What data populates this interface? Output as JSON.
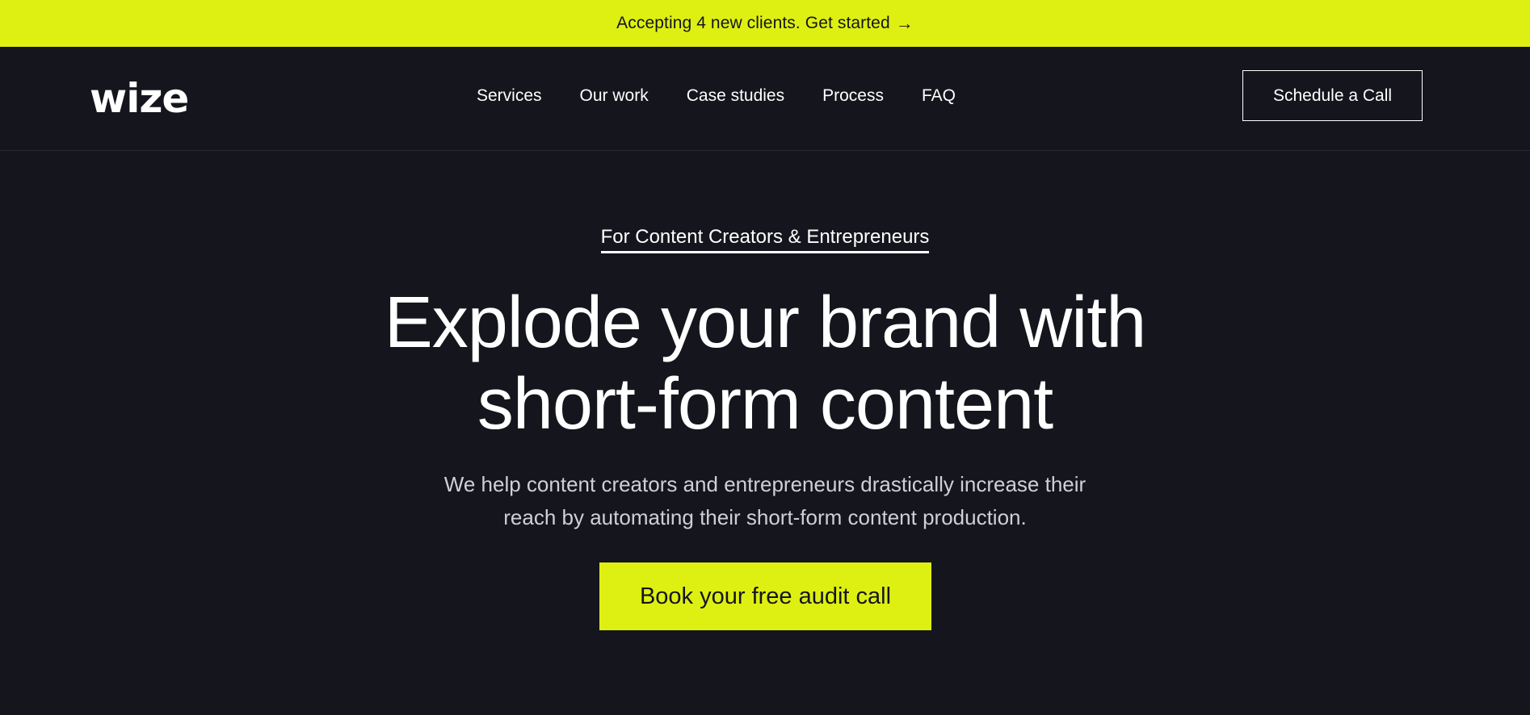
{
  "announcement": {
    "text": "Accepting 4 new clients. Get started",
    "arrow": "→"
  },
  "header": {
    "logo": "wize",
    "nav": [
      "Services",
      "Our work",
      "Case studies",
      "Process",
      "FAQ"
    ],
    "cta": "Schedule a Call"
  },
  "hero": {
    "eyebrow": "For Content Creators & Entrepreneurs",
    "headline_line1": "Explode your brand with",
    "headline_line2": "short-form content",
    "sub_line1": "We help content creators and entrepreneurs drastically increase their",
    "sub_line2": "reach by automating their short-form content production.",
    "cta": "Book your free audit call"
  },
  "colors": {
    "accent": "#def012",
    "background": "#15151d",
    "text": "#ffffff"
  }
}
